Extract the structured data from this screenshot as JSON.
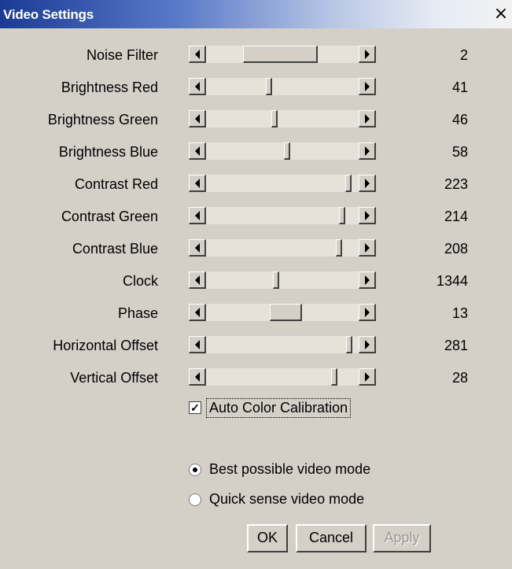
{
  "window": {
    "title": "Video Settings",
    "close_symbol": "×"
  },
  "sliders": [
    {
      "label": "Noise Filter",
      "value": "2",
      "thumb_start": 0.24,
      "thumb_end": 0.73
    },
    {
      "label": "Brightness Red",
      "value": "41",
      "thumb_start": 0.39,
      "thumb_end": 0.43
    },
    {
      "label": "Brightness Green",
      "value": "46",
      "thumb_start": 0.43,
      "thumb_end": 0.47
    },
    {
      "label": "Brightness Blue",
      "value": "58",
      "thumb_start": 0.51,
      "thumb_end": 0.55
    },
    {
      "label": "Contrast Red",
      "value": "223",
      "thumb_start": 0.91,
      "thumb_end": 0.95
    },
    {
      "label": "Contrast Green",
      "value": "214",
      "thumb_start": 0.87,
      "thumb_end": 0.91
    },
    {
      "label": "Contrast Blue",
      "value": "208",
      "thumb_start": 0.85,
      "thumb_end": 0.89
    },
    {
      "label": "Clock",
      "value": "1344",
      "thumb_start": 0.44,
      "thumb_end": 0.48
    },
    {
      "label": "Phase",
      "value": "13",
      "thumb_start": 0.42,
      "thumb_end": 0.63
    },
    {
      "label": "Horizontal Offset",
      "value": "281",
      "thumb_start": 0.92,
      "thumb_end": 0.96
    },
    {
      "label": "Vertical Offset",
      "value": "28",
      "thumb_start": 0.82,
      "thumb_end": 0.86
    }
  ],
  "auto_color_calibration": {
    "label": "Auto Color Calibration",
    "checked": true,
    "check_mark": "✓"
  },
  "video_mode": {
    "selected": "best",
    "options": [
      {
        "id": "best",
        "label": "Best possible video mode"
      },
      {
        "id": "quick",
        "label": "Quick sense video mode"
      }
    ]
  },
  "buttons": {
    "ok": "OK",
    "cancel": "Cancel",
    "apply": "Apply"
  }
}
